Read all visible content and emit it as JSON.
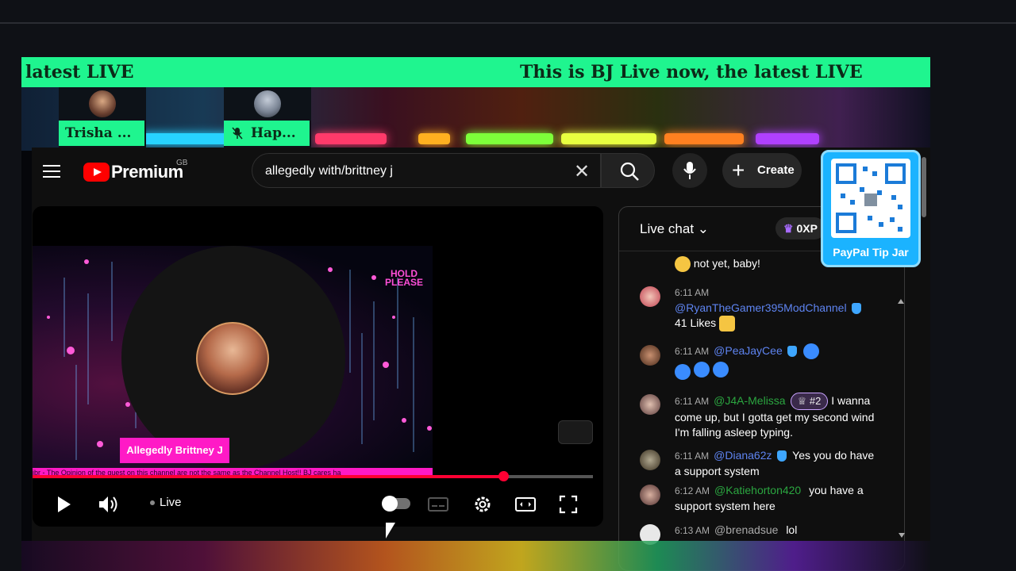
{
  "ticker": {
    "left_text": "latest LIVE",
    "right_text": "This is BJ Live now, the latest LIVE"
  },
  "guests": [
    {
      "name": "Trisha ..."
    },
    {
      "name": "Hap..."
    }
  ],
  "qr": {
    "label": "PayPal Tip Jar"
  },
  "youtube": {
    "logo_text": "Premium",
    "region": "GB",
    "search_value": "allegedly with/brittney j",
    "create_label": "Create"
  },
  "player": {
    "hold_text_line1": "HOLD",
    "hold_text_line2": "PLEASE",
    "name_tag": "Allegedly Brittney J",
    "marquee_text": "ibr - The Opinion of the guest on this channel are not the same as the Channel Host!! BJ cares ha",
    "live_label": "Live",
    "progress_fraction": 0.84
  },
  "chat": {
    "title": "Live chat",
    "xp": "0XP",
    "messages": [
      {
        "time": "",
        "user": "",
        "text": "not yet, baby!",
        "user_color": "#fff"
      },
      {
        "time": "6:11 AM",
        "user": "@RyanTheGamer395ModChannel",
        "text": "41 Likes",
        "user_color": "#5e84f1"
      },
      {
        "time": "6:11 AM",
        "user": "@PeaJayCee",
        "text": "",
        "user_color": "#5e84f1"
      },
      {
        "time": "6:11 AM",
        "user": "@J4A-Melissa",
        "rank": "#2",
        "text": "I wanna come up, but I gotta get my second wind I'm falling asleep typing.",
        "user_color": "#2ba640"
      },
      {
        "time": "6:11 AM",
        "user": "@Diana62z",
        "text": "Yes you do have a support system",
        "user_color": "#5e84f1"
      },
      {
        "time": "6:12 AM",
        "user": "@Katiehorton420",
        "text": "you have a support system here",
        "user_color": "#2ba640"
      },
      {
        "time": "6:13 AM",
        "user": "@brenadsue",
        "text": "lol",
        "user_color": "#aaaaaa"
      }
    ]
  }
}
